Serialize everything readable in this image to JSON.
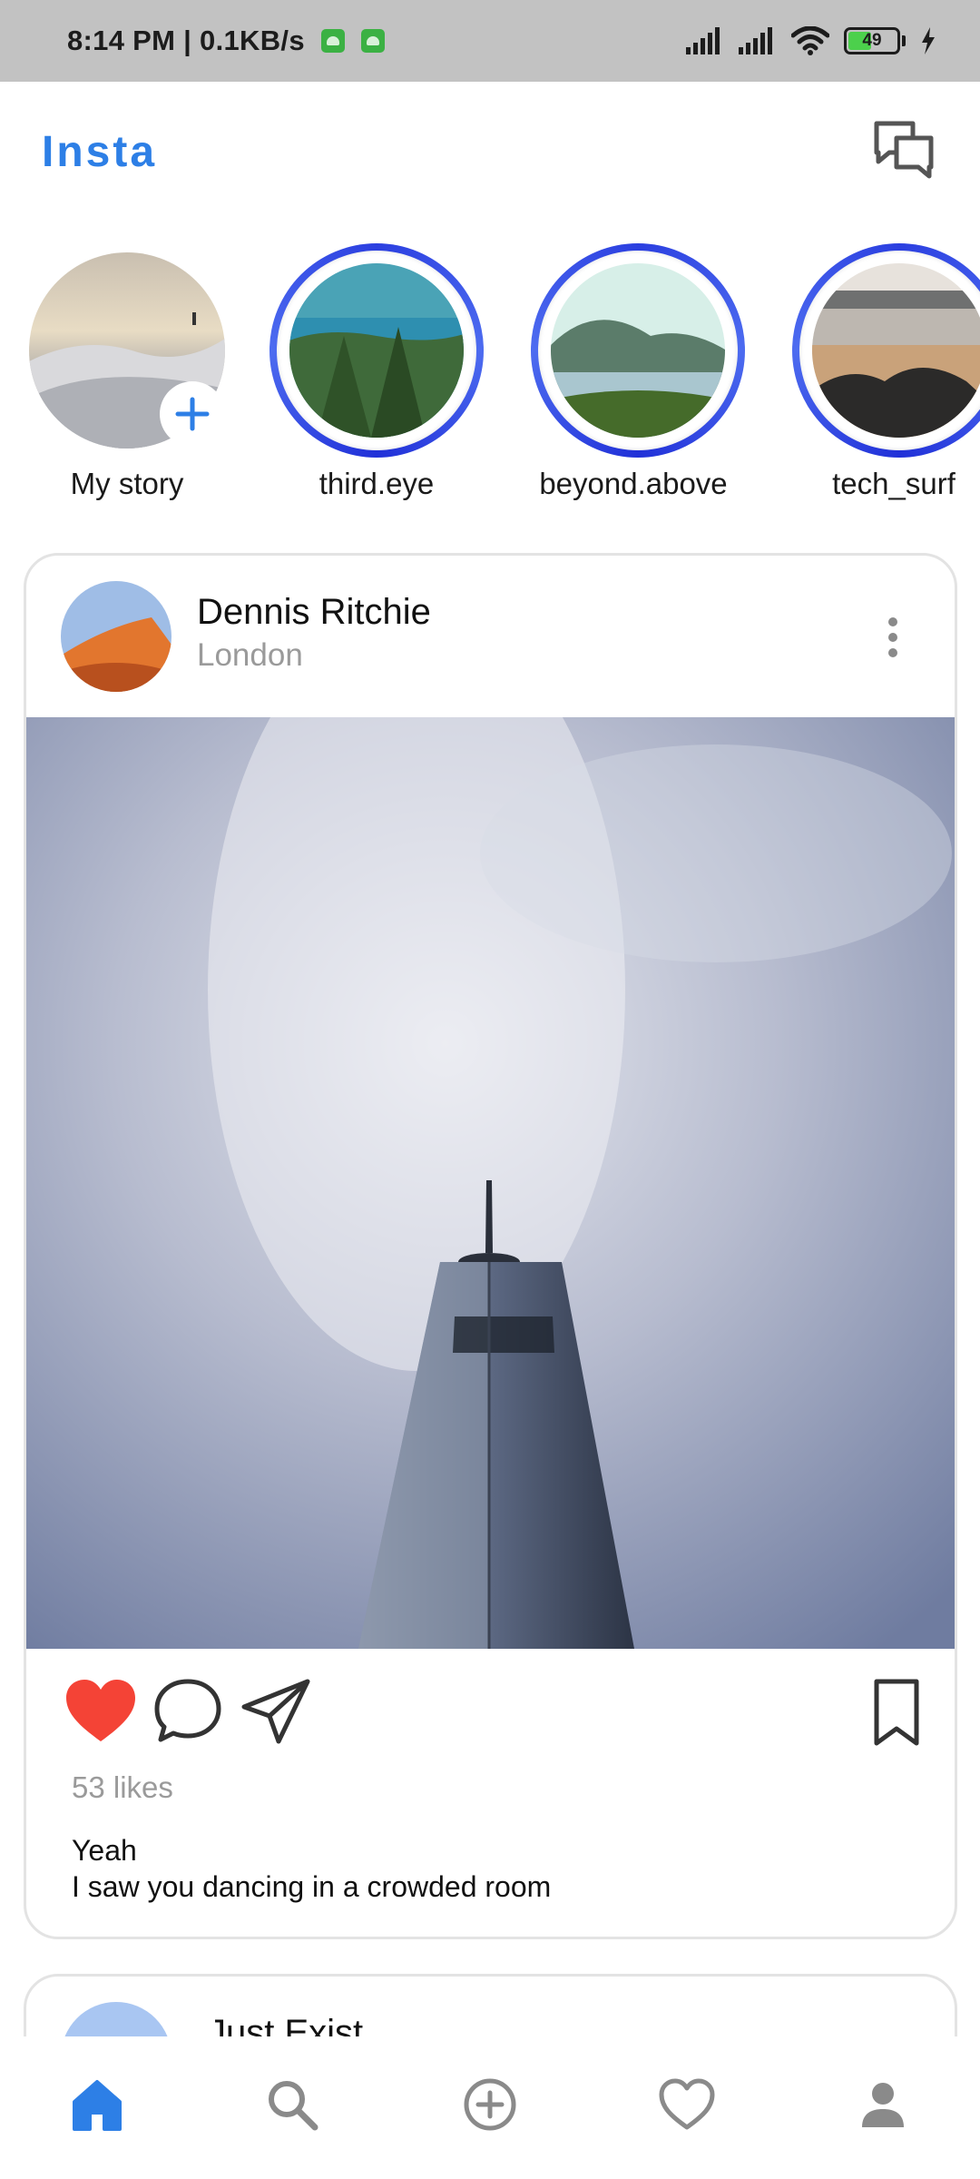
{
  "status_bar": {
    "time": "8:14 PM | 0.1KB/s",
    "battery": "49",
    "battery_level": 0.49
  },
  "header": {
    "title": "Insta",
    "messages_icon": "chat-bubbles-icon"
  },
  "stories": [
    {
      "label": "My story",
      "is_own": true,
      "add_icon": "plus-icon"
    },
    {
      "label": "third.eye"
    },
    {
      "label": "beyond.above"
    },
    {
      "label": "tech_surf"
    }
  ],
  "post": {
    "author": "Dennis Ritchie",
    "location": "London",
    "likes": "53 likes",
    "liked": true,
    "caption_lines": [
      "Yeah",
      "I saw you dancing in a crowded room"
    ],
    "icons": {
      "like": "heart-filled-icon",
      "comment": "comment-bubble-icon",
      "share": "paper-plane-icon",
      "save": "bookmark-icon",
      "more": "more-vertical-icon"
    }
  },
  "next_post": {
    "author": "Just Exist"
  },
  "bottom_nav": [
    {
      "icon": "home-icon",
      "active": true
    },
    {
      "icon": "search-icon",
      "active": false
    },
    {
      "icon": "add-circle-icon",
      "active": false
    },
    {
      "icon": "heart-outline-icon",
      "active": false
    },
    {
      "icon": "profile-icon",
      "active": false
    }
  ],
  "colors": {
    "accent": "#2d7fe6",
    "story_ring": "#2b3fe0",
    "like": "#f44336",
    "muted_text": "#9a9a9a",
    "status_bar_bg": "#c2c2c2"
  }
}
